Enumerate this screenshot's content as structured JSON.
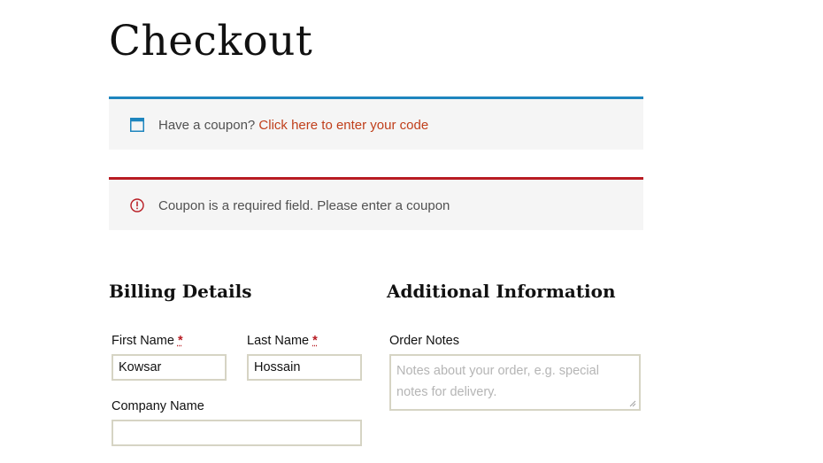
{
  "page": {
    "title": "Checkout"
  },
  "coupon_notice": {
    "icon": "window-icon",
    "text": "Have a coupon?",
    "link_label": "Click here to enter your code",
    "accent_color": "#1e85be",
    "link_color": "#c03f1b"
  },
  "error_notice": {
    "icon": "alert-circle-icon",
    "text": "Coupon is a required field. Please enter a coupon",
    "accent_color": "#b81c23"
  },
  "billing": {
    "heading": "Billing Details",
    "required_marker": "*",
    "first_name": {
      "label": "First Name",
      "value": "Kowsar"
    },
    "last_name": {
      "label": "Last Name",
      "value": "Hossain"
    },
    "company_name": {
      "label": "Company Name",
      "value": ""
    }
  },
  "additional": {
    "heading": "Additional Information",
    "order_notes": {
      "label": "Order Notes",
      "placeholder": "Notes about your order, e.g. special notes for delivery.",
      "value": ""
    }
  }
}
